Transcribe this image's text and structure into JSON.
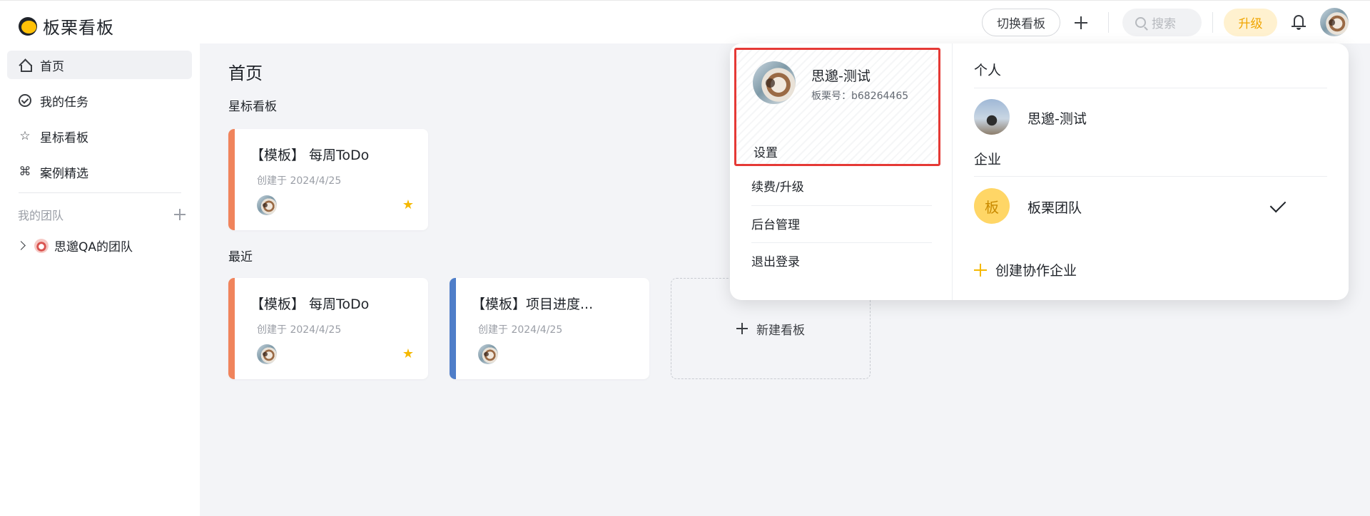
{
  "app": {
    "logo_text": "板栗看板"
  },
  "header": {
    "switch_board": "切换看板",
    "search_placeholder": "搜索",
    "upgrade": "升级"
  },
  "sidebar": {
    "items": [
      {
        "label": "首页",
        "icon": "home-icon",
        "active": true
      },
      {
        "label": "我的任务",
        "icon": "check-circle-icon"
      },
      {
        "label": "星标看板",
        "icon": "star-icon"
      },
      {
        "label": "案例精选",
        "icon": "command-icon"
      }
    ],
    "team_heading": "我的团队",
    "teams": [
      {
        "label": "思邈QA的团队"
      }
    ]
  },
  "main": {
    "title": "首页",
    "starred": {
      "label": "星标看板",
      "cards": [
        {
          "title": "【模板】 每周ToDo",
          "date": "创建于 2024/4/25",
          "color": "#f0845c",
          "starred": true
        }
      ]
    },
    "recent": {
      "label": "最近",
      "cards": [
        {
          "title": "【模板】 每周ToDo",
          "date": "创建于 2024/4/25",
          "color": "#f0845c",
          "starred": true
        },
        {
          "title": "【模板】项目进度...",
          "date": "创建于 2024/4/25",
          "color": "#4f7ec9",
          "starred": false
        }
      ],
      "new_board": "新建看板"
    }
  },
  "dropdown": {
    "profile": {
      "name": "思邈-测试",
      "id_text": "板栗号：b68264465"
    },
    "menu": [
      "设置",
      "续费/升级",
      "后台管理",
      "退出登录"
    ],
    "personal_heading": "个人",
    "personal_name": "思邈-测试",
    "org_heading": "企业",
    "org_avatar_char": "板",
    "org_name": "板栗团队",
    "create_org": "创建协作企业"
  },
  "colors": {
    "accent": "#f5b800",
    "highlight": "#e53935",
    "background": "#f3f4f7"
  }
}
